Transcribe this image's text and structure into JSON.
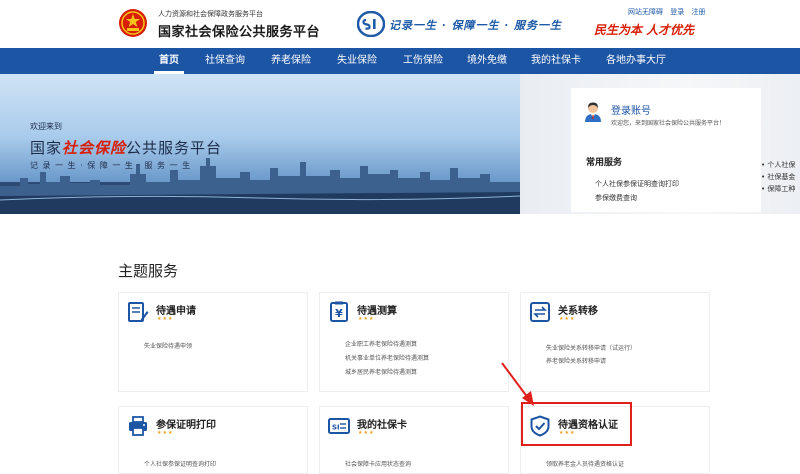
{
  "header": {
    "brand_small": "人力资源和社会保障政务服务平台",
    "brand_main": "国家社会保险公共服务平台",
    "slogan": "记录一生 · 保障一生 · 服务一生",
    "top_links": [
      "网站无障碍",
      "登录",
      "注册"
    ],
    "red_slogan": "民生为本 人才优先"
  },
  "nav": {
    "items": [
      "首页",
      "社保查询",
      "养老保险",
      "失业保险",
      "工伤保险",
      "境外免缴",
      "我的社保卡",
      "各地办事大厅"
    ]
  },
  "banner": {
    "welcome": "欢迎来到",
    "title_prefix": "国家",
    "title_highlight": "社会保险",
    "title_suffix": "公共服务平台",
    "subtitle": "记 录 一 生 · 保 障 一 生 · 服 务 一 生"
  },
  "login": {
    "title": "登录账号",
    "desc": "欢迎您，来到国家社会保险公共服务平台！",
    "common_title": "常用服务",
    "common_items": [
      "个人社保参保证明查询打印",
      "参保缴费查询"
    ],
    "side_tags": [
      "• 个人社保",
      "• 社保基金",
      "• 保障工种"
    ]
  },
  "services": {
    "title": "主题服务",
    "cards": [
      {
        "title": "待遇申请",
        "items": [
          "失业保险待遇申领"
        ]
      },
      {
        "title": "待遇测算",
        "items": [
          "企业职工养老保险待遇测算",
          "机关事业单位养老保险待遇测算",
          "城乡居民养老保险待遇测算"
        ]
      },
      {
        "title": "关系转移",
        "items": [
          "失业保险关系转移申请（试运行）",
          "养老保险关系转移申请"
        ]
      },
      {
        "title": "参保证明打印",
        "items": [
          "个人社保参保证明查询打印"
        ]
      },
      {
        "title": "我的社保卡",
        "items": [
          "社会保障卡应用状态查询"
        ]
      },
      {
        "title": "待遇资格认证",
        "items": [
          "领取养老金人员待遇资格认证"
        ]
      }
    ],
    "stars": "★★★"
  },
  "colors": {
    "nav_bg": "#1d55a5",
    "accent_red": "#d81e06",
    "highlight_border": "#e0201b"
  }
}
